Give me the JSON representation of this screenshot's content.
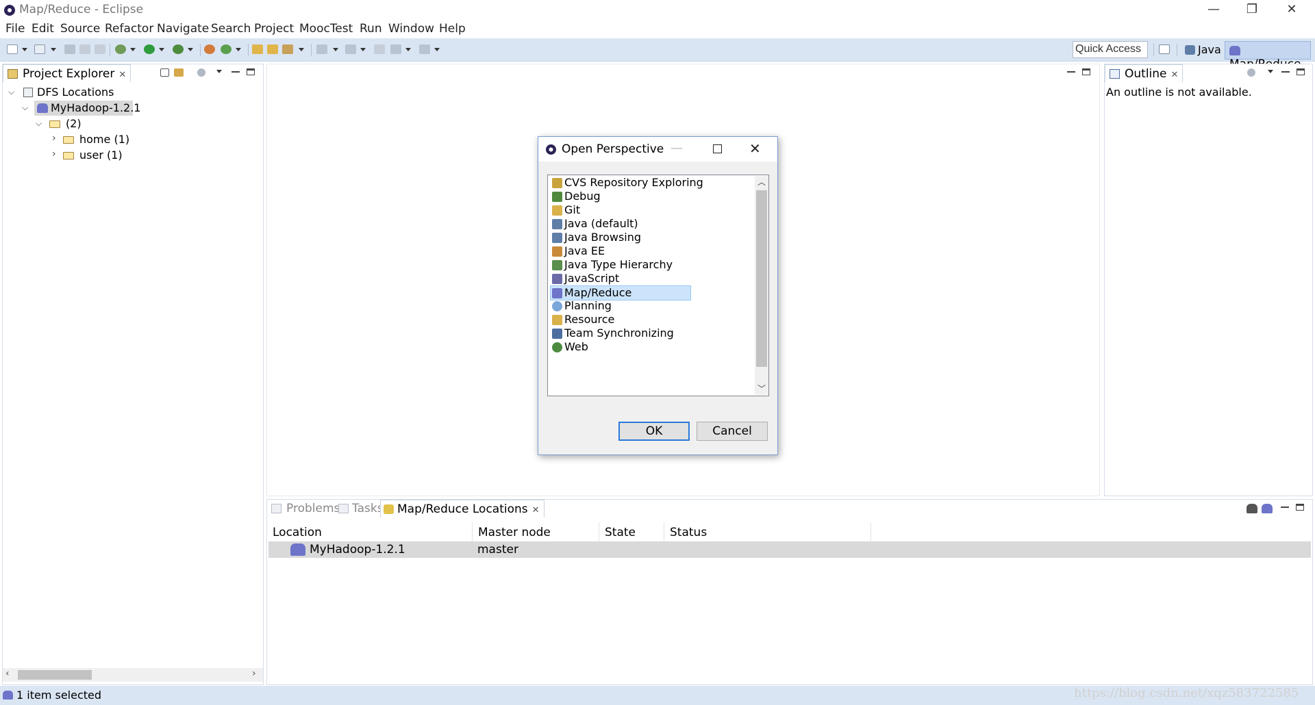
{
  "window": {
    "title": "Map/Reduce - Eclipse",
    "controls": {
      "minimize": "—",
      "restore": "❐",
      "close": "✕"
    }
  },
  "menu": [
    "File",
    "Edit",
    "Source",
    "Refactor",
    "Navigate",
    "Search",
    "Project",
    "MoocTest",
    "Run",
    "Window",
    "Help"
  ],
  "toolbar": {
    "quick_access": "Quick Access",
    "perspectives": [
      "Java",
      "Map/Reduce"
    ],
    "active_perspective": "Map/Reduce"
  },
  "project_explorer": {
    "tab_label": "Project Explorer",
    "tree": {
      "root": "DFS Locations",
      "location": "MyHadoop-1.2.1",
      "folder": "(2)",
      "children": [
        "home (1)",
        "user (1)"
      ]
    }
  },
  "outline": {
    "tab_label": "Outline",
    "message": "An outline is not available."
  },
  "dialog": {
    "title": "Open Perspective",
    "items": [
      {
        "label": "CVS Repository Exploring",
        "icon": "cvs-icon",
        "color": "#c9a43e"
      },
      {
        "label": "Debug",
        "icon": "bug-icon",
        "color": "#4f8a3c"
      },
      {
        "label": "Git",
        "icon": "git-icon",
        "color": "#d9b24a"
      },
      {
        "label": "Java (default)",
        "icon": "java-icon",
        "color": "#5e7ea8"
      },
      {
        "label": "Java Browsing",
        "icon": "java-browsing-icon",
        "color": "#5e7ea8"
      },
      {
        "label": "Java EE",
        "icon": "javaee-icon",
        "color": "#c98b3a"
      },
      {
        "label": "Java Type Hierarchy",
        "icon": "hierarchy-icon",
        "color": "#5a8f4e"
      },
      {
        "label": "JavaScript",
        "icon": "javascript-icon",
        "color": "#6a6aa8"
      },
      {
        "label": "Map/Reduce",
        "icon": "elephant-icon",
        "color": "#6d74c9"
      },
      {
        "label": "Planning",
        "icon": "planning-icon",
        "color": "#7aa7d9"
      },
      {
        "label": "Resource",
        "icon": "resource-icon",
        "color": "#d9b24a"
      },
      {
        "label": "Team Synchronizing",
        "icon": "sync-icon",
        "color": "#4d6fa0"
      },
      {
        "label": "Web",
        "icon": "web-icon",
        "color": "#4c8b3f"
      }
    ],
    "selected": "Map/Reduce",
    "ok_label": "OK",
    "cancel_label": "Cancel"
  },
  "bottom": {
    "tabs": [
      "Problems",
      "Tasks",
      "Map/Reduce Locations"
    ],
    "active_tab": "Map/Reduce Locations",
    "columns": [
      "Location",
      "Master node",
      "State",
      "Status"
    ],
    "rows": [
      {
        "location": "MyHadoop-1.2.1",
        "master": "master",
        "state": "",
        "status": ""
      }
    ]
  },
  "status": {
    "text": "1 item selected"
  },
  "watermark": "https://blog.csdn.net/xqz583722585"
}
